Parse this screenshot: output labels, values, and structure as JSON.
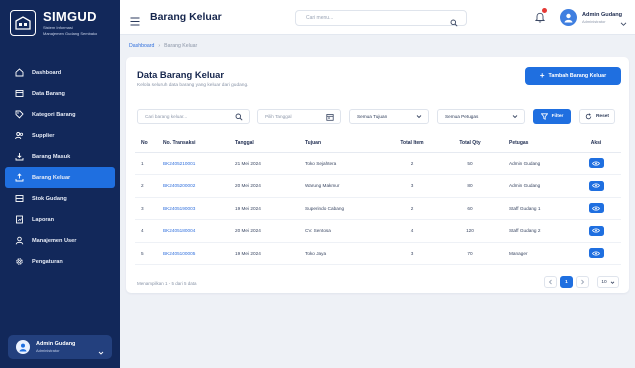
{
  "app": {
    "name": "SIMGUD",
    "subtitle_line1": "Sistem Informasi",
    "subtitle_line2": "Manajemen Gudang Sembako"
  },
  "sidebar": {
    "items": [
      {
        "label": "Dashboard",
        "icon": "home-icon"
      },
      {
        "label": "Data Barang",
        "icon": "box-icon"
      },
      {
        "label": "Kategori Barang",
        "icon": "tag-icon"
      },
      {
        "label": "Supplier",
        "icon": "users-icon"
      },
      {
        "label": "Barang Masuk",
        "icon": "upload-icon"
      },
      {
        "label": "Barang Keluar",
        "icon": "upload-icon",
        "active": true
      },
      {
        "label": "Stok Gudang",
        "icon": "box-icon"
      },
      {
        "label": "Laporan",
        "icon": "report-icon"
      },
      {
        "label": "Manajemen User",
        "icon": "user-icon"
      },
      {
        "label": "Pengaturan",
        "icon": "gear-icon"
      }
    ],
    "user": {
      "name": "Admin Gudang",
      "role": "Administrator"
    }
  },
  "header": {
    "title": "Barang Keluar",
    "search_placeholder": "Cari menu...",
    "user_name": "Admin Gudang",
    "user_role": "Administrator"
  },
  "breadcrumb": {
    "root": "Dashboard",
    "current": "Barang Keluar"
  },
  "page": {
    "title": "Data Barang Keluar",
    "subtitle": "Kelola seluruh data barang yang keluar dari gudang.",
    "add_button": "Tambah Barang Keluar"
  },
  "filters": {
    "search_placeholder": "Cari barang keluar...",
    "date_placeholder": "Pilih Tanggal",
    "tujuan": "Semua Tujuan",
    "petugas": "Semua Petugas",
    "filter_button": "Filter",
    "reset_button": "Reset"
  },
  "table": {
    "headers": {
      "no": "No",
      "trx": "No. Transaksi",
      "tgl": "Tanggal",
      "tujuan": "Tujuan",
      "item": "Total Item",
      "qty": "Total Qty",
      "petugas": "Petugas",
      "aksi": "Aksi"
    },
    "rows": [
      {
        "no": "1",
        "trx": "BK2405210001",
        "tgl": "21 Mei 2024",
        "tujuan": "Toko Sejahtera",
        "item": "2",
        "qty": "50",
        "petugas": "Admin Gudang"
      },
      {
        "no": "2",
        "trx": "BK2405200002",
        "tgl": "20 Mei 2024",
        "tujuan": "Warung Makmur",
        "item": "3",
        "qty": "80",
        "petugas": "Admin Gudang"
      },
      {
        "no": "3",
        "trx": "BK2405190003",
        "tgl": "19 Mei 2024",
        "tujuan": "Superindo Cabang",
        "item": "2",
        "qty": "60",
        "petugas": "Staff Gudang 1"
      },
      {
        "no": "4",
        "trx": "BK2405180004",
        "tgl": "20 Mei 2024",
        "tujuan": "CV. Sentosa",
        "item": "4",
        "qty": "120",
        "petugas": "Staff Gudang 2"
      },
      {
        "no": "5",
        "trx": "BK2405100005",
        "tgl": "19 Mei 2024",
        "tujuan": "Toko Jaya",
        "item": "3",
        "qty": "70",
        "petugas": "Manager"
      }
    ]
  },
  "pagination": {
    "info": "Menampilkan 1 - 5 dari 5 data",
    "current_page": "1",
    "page_size": "10"
  },
  "colors": {
    "primary": "#1f6fe0",
    "sidebar": "#12285a"
  }
}
